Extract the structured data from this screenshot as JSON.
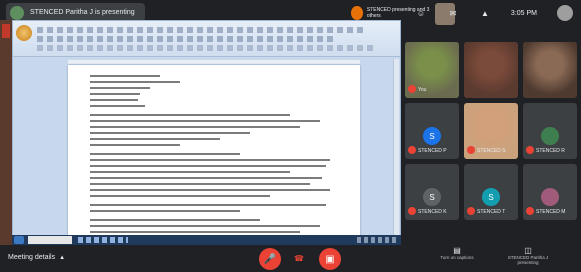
{
  "topbar": {
    "presenting_label": "STENCED Paritha J is presenting",
    "presenter_chip_label": "STENCED presenting and 3 others",
    "time": "3:05 PM",
    "icons": [
      "people-icon",
      "chat-icon",
      "activities-icon",
      "account-avatar"
    ]
  },
  "participants": [
    {
      "name": "You",
      "color": "#7a8f4a",
      "initial": "",
      "muted": true,
      "video": true,
      "photo": "#6b6b4f"
    },
    {
      "name": "",
      "color": "#7a4a3a",
      "initial": "",
      "muted": false,
      "video": true,
      "photo": "#5b3a2f"
    },
    {
      "name": "",
      "color": "#8a6a55",
      "initial": "",
      "muted": false,
      "video": true,
      "photo": "#4f3a30"
    },
    {
      "name": "STENCED P",
      "color": "#1a73e8",
      "initial": "S",
      "muted": true,
      "video": false
    },
    {
      "name": "STENCED S",
      "color": "#d2a07a",
      "initial": "",
      "muted": true,
      "video": true,
      "photo": "#c9a27c"
    },
    {
      "name": "STENCED R",
      "color": "#3f7f4f",
      "initial": "",
      "muted": true,
      "video": false
    },
    {
      "name": "STENCED K",
      "color": "#5f6368",
      "initial": "S",
      "muted": true,
      "video": false
    },
    {
      "name": "STENCED T",
      "color": "#129eaf",
      "initial": "S",
      "muted": true,
      "video": false
    },
    {
      "name": "STENCED M",
      "color": "#a05a7a",
      "initial": "",
      "muted": true,
      "video": false
    }
  ],
  "bottombar": {
    "meeting_details_label": "Meeting details",
    "turn_on_captions_label": "Turn on captions",
    "present_now_label": "STENCED Paritha J presenting"
  }
}
